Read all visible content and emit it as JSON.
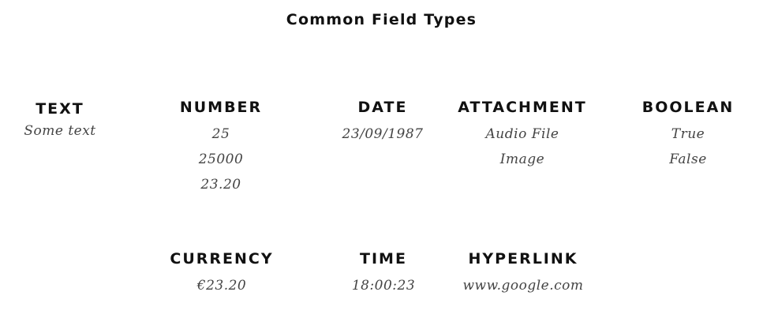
{
  "title": "Common Field Types",
  "fields": {
    "text": {
      "label": "TEXT",
      "values": [
        "Some text"
      ]
    },
    "number": {
      "label": "NUMBER",
      "values": [
        "25",
        "25000",
        "23.20"
      ]
    },
    "date": {
      "label": "DATE",
      "values": [
        "23/09/1987"
      ]
    },
    "attachment": {
      "label": "ATTACHMENT",
      "values": [
        "Audio File",
        "Image"
      ]
    },
    "boolean": {
      "label": "BOOLEAN",
      "values": [
        "True",
        "False"
      ]
    },
    "currency": {
      "label": "CURRENCY",
      "values": [
        "€23.20"
      ]
    },
    "time": {
      "label": "TIME",
      "values": [
        "18:00:23"
      ]
    },
    "hyperlink": {
      "label": "HYPERLINK",
      "values": [
        "www.google.com"
      ]
    }
  }
}
